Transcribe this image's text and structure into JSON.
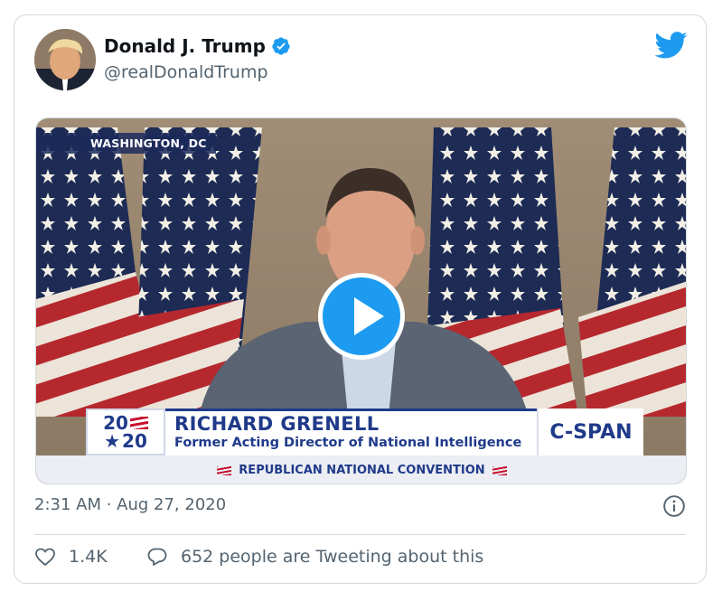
{
  "tweet": {
    "author_name": "Donald J. Trump",
    "author_handle": "@realDonaldTrump",
    "timestamp": "2:31 AM · Aug 27, 2020",
    "likes": "1.4K",
    "replies_text": "652 people are Tweeting about this"
  },
  "video": {
    "location": "WASHINGTON, DC",
    "lower_third_name": "RICHARD GRENELL",
    "lower_third_title": "Former Acting Director of National Intelligence",
    "logo_top": "20",
    "logo_bottom": "20",
    "network": "C-SPAN",
    "banner": "REPUBLICAN NATIONAL CONVENTION"
  },
  "icons": {
    "verified": "verified-badge-icon",
    "brand": "twitter-bird-icon",
    "play": "play-icon",
    "info": "info-icon",
    "like": "heart-icon",
    "reply": "reply-bubble-icon"
  },
  "colors": {
    "accent": "#1d9bf0",
    "muted": "#536471",
    "border": "#cfd9de",
    "broadcast_navy": "#1f3a8a"
  }
}
